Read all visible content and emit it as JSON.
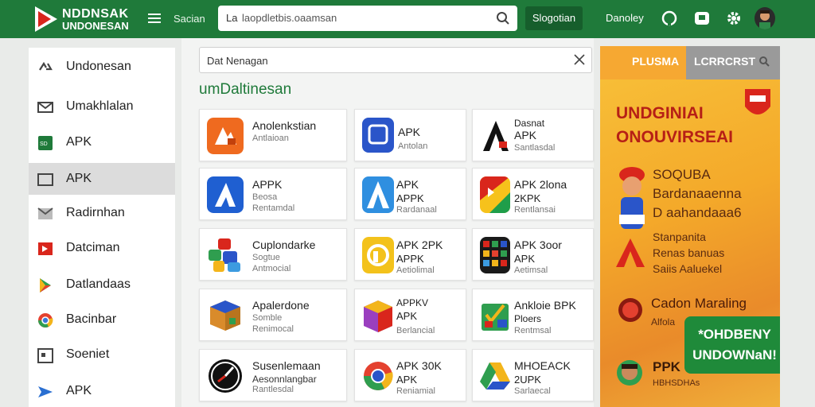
{
  "header": {
    "logo_line1": "NDDNSAK",
    "logo_line2": "UNDONESAN",
    "section_link": "Sacian",
    "search_prefix": "La",
    "search_value": "laopdletbis.oaamsan",
    "search_button": "Slogotian",
    "user_name": "Danoley"
  },
  "sidebar": {
    "items": [
      {
        "label": "Undonesan",
        "icon": "recycle-icon"
      },
      {
        "label": "Umakhlalan",
        "icon": "mail-icon"
      },
      {
        "label": "APK",
        "icon": "sd-card-icon"
      },
      {
        "label": "APK",
        "icon": "window-icon",
        "active": true
      },
      {
        "label": "Radirnhan",
        "icon": "envelope-icon"
      },
      {
        "label": "Datciman",
        "icon": "flag-icon"
      },
      {
        "label": "Datlandaas",
        "icon": "play-store-icon"
      },
      {
        "label": "Bacinbar",
        "icon": "chrome-icon"
      },
      {
        "label": "Soeniet",
        "icon": "calendar-icon"
      },
      {
        "label": "APK",
        "icon": "send-icon"
      }
    ]
  },
  "main": {
    "filter_text": "Dat Nenagan",
    "section_title": "umDaltinesan",
    "cards": [
      {
        "name": "Anolenkstian",
        "sub1": "Antlaioan",
        "sub2": "",
        "icon": "orange-app-icon"
      },
      {
        "name": "APK",
        "sub1": "Antolan",
        "sub2": "",
        "icon": "blue-square-app-icon"
      },
      {
        "name": "Dasnat",
        "name2": "APK",
        "sub1": "Santlasdal",
        "icon": "letter-a-app-icon"
      },
      {
        "name": "APPK",
        "sub1": "Beosa",
        "sub2": "Rentamdal",
        "icon": "blue-triangle-app-icon"
      },
      {
        "name": "APK",
        "sub1": "APPK",
        "sub2": "Rardanaal",
        "icon": "blue-a-app-icon"
      },
      {
        "name": "APK 2lona",
        "sub1": "2KPK",
        "sub2": "Rentlansai",
        "icon": "colorful-folder-app-icon"
      },
      {
        "name": "Cuplondarke",
        "sub1": "Sogtue",
        "sub2": "Antmocial",
        "icon": "puzzle-app-icon"
      },
      {
        "name": "APK 2PK",
        "sub1": "APPK",
        "sub2": "Aetiolimal",
        "icon": "yellow-p-app-icon"
      },
      {
        "name": "APK 3oor",
        "sub1": "APK",
        "sub2": "Aetimsal",
        "icon": "calculator-app-icon"
      },
      {
        "name": "Apalerdone",
        "sub1": "Somble",
        "sub2": "Renimocal",
        "icon": "cube-app-icon"
      },
      {
        "name": "APPKV",
        "sub1": "APK",
        "sub2": "Berlancial",
        "icon": "box-app-icon"
      },
      {
        "name": "Ankloie BPK",
        "sub1": "Ploers",
        "sub2": "Rentmsal",
        "icon": "checklist-app-icon"
      },
      {
        "name": "Susenlemaan",
        "sub1": "Aesonnlangbar",
        "sub2": "Rantlesdal",
        "icon": "clock-app-icon"
      },
      {
        "name": "APK 30K",
        "sub1": "APK",
        "sub2": "Reniamial",
        "icon": "chrome-app-icon"
      },
      {
        "name": "MHOEACK",
        "sub1": "2UPK",
        "sub2": "Sarlaecal",
        "icon": "drive-app-icon"
      }
    ]
  },
  "ad": {
    "tab1": "PLUSMA",
    "tab2": "LCRRCRST",
    "headline": "UNDGINIAI ONOUVIRSEAI",
    "body": [
      "SOQUBA",
      "Bardanaaenna",
      "D aahandaaa6"
    ],
    "body2": [
      "Stanpanita",
      "Renas banuas",
      "Saiis Aaluekel"
    ],
    "offer": "Cadon Maraling",
    "offer_sub": "Alfola",
    "green_text": "*OHDBENY UNDOWNaN!",
    "bottom": "PPK",
    "bottom_sub": "HBHSDHAs",
    "colors": {
      "brand": "#1f7a3a",
      "accent": "#b61f16"
    }
  }
}
